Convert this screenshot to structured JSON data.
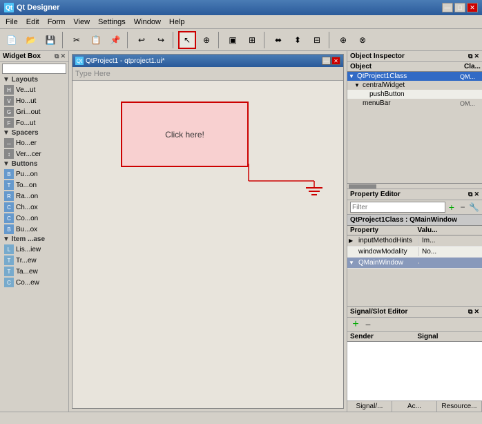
{
  "app": {
    "title": "Qt Designer",
    "icon": "Qt"
  },
  "menubar": {
    "items": [
      "File",
      "Edit",
      "Form",
      "View",
      "Settings",
      "Window",
      "Help"
    ]
  },
  "toolbar": {
    "tools": [
      {
        "name": "new",
        "icon": "📄"
      },
      {
        "name": "open",
        "icon": "📂"
      },
      {
        "name": "save",
        "icon": "💾"
      },
      {
        "name": "sep1",
        "type": "sep"
      },
      {
        "name": "cut",
        "icon": "✂"
      },
      {
        "name": "copy",
        "icon": "📋"
      },
      {
        "name": "paste",
        "icon": "📌"
      },
      {
        "name": "sep2",
        "type": "sep"
      },
      {
        "name": "pointer",
        "icon": "↖",
        "active": true
      },
      {
        "name": "connect",
        "icon": "🔗"
      },
      {
        "name": "sep3",
        "type": "sep"
      },
      {
        "name": "edit1",
        "icon": "▣"
      },
      {
        "name": "edit2",
        "icon": "⊞"
      },
      {
        "name": "edit3",
        "icon": "≡"
      },
      {
        "name": "sep4",
        "type": "sep"
      },
      {
        "name": "arrange1",
        "icon": "⬌"
      },
      {
        "name": "arrange2",
        "icon": "⬍"
      },
      {
        "name": "arrange3",
        "icon": "⬛"
      },
      {
        "name": "sep5",
        "type": "sep"
      },
      {
        "name": "zoom",
        "icon": "🔍"
      },
      {
        "name": "more1",
        "icon": "⊕"
      },
      {
        "name": "more2",
        "icon": "⊗"
      }
    ]
  },
  "widget_box": {
    "title": "Widget Box",
    "search_placeholder": "",
    "categories": [
      {
        "name": "Layouts",
        "items": [
          {
            "label": "Ve...ut",
            "icon": "H"
          },
          {
            "label": "Ho...ut",
            "icon": "V"
          },
          {
            "label": "Gri...out",
            "icon": "G"
          },
          {
            "label": "Fo...ut",
            "icon": "F"
          }
        ]
      },
      {
        "name": "Spacers",
        "items": [
          {
            "label": "Ho...er",
            "icon": "↔"
          },
          {
            "label": "Ver...cer",
            "icon": "↕"
          }
        ]
      },
      {
        "name": "Buttons",
        "items": [
          {
            "label": "Pu...on",
            "icon": "B"
          },
          {
            "label": "To...on",
            "icon": "T"
          },
          {
            "label": "Ra...on",
            "icon": "R"
          },
          {
            "label": "Ch...ox",
            "icon": "C"
          },
          {
            "label": "Co...on",
            "icon": "C"
          },
          {
            "label": "Bu...ox",
            "icon": "B"
          }
        ]
      },
      {
        "name": "Item ...ase",
        "items": [
          {
            "label": "Lis...iew",
            "icon": "L"
          },
          {
            "label": "Tr...ew",
            "icon": "T"
          },
          {
            "label": "Ta...ew",
            "icon": "T"
          },
          {
            "label": "Co...ew",
            "icon": "C"
          }
        ]
      }
    ]
  },
  "sub_window": {
    "title": "QtProject1 - qtproject1.ui*",
    "menu_placeholder": "Type Here",
    "button_label": "Click here!"
  },
  "object_inspector": {
    "title": "Object Inspector",
    "col_object": "Object",
    "col_class": "Cla...",
    "rows": [
      {
        "indent": 0,
        "expand": "▼",
        "name": "QtProject1Class",
        "class": "QM..."
      },
      {
        "indent": 1,
        "expand": "▼",
        "name": "centralWidget",
        "class": ""
      },
      {
        "indent": 2,
        "expand": "",
        "name": "pushButton",
        "class": ""
      },
      {
        "indent": 1,
        "expand": "",
        "name": "menuBar",
        "class": "OM..."
      }
    ],
    "selected_row": 0
  },
  "property_editor": {
    "title": "Property Editor",
    "filter_placeholder": "Filter",
    "context": "QtProject1Class : QMainWindow",
    "col_property": "Property",
    "col_value": "Valu...",
    "rows": [
      {
        "expand": "▶",
        "name": "inputMethodHints",
        "value": "Im...",
        "alt": false
      },
      {
        "expand": "",
        "name": "windowModality",
        "value": "No...",
        "alt": true
      },
      {
        "expand": "",
        "name": "QMainWindow",
        "value": "",
        "group": true
      }
    ]
  },
  "signal_editor": {
    "title": "Signal/Slot Editor",
    "col_sender": "Sender",
    "col_signal": "Signal",
    "footer_tabs": [
      "Signal/...",
      "Ac...",
      "Resource..."
    ]
  },
  "status_bar": {
    "text": ""
  }
}
